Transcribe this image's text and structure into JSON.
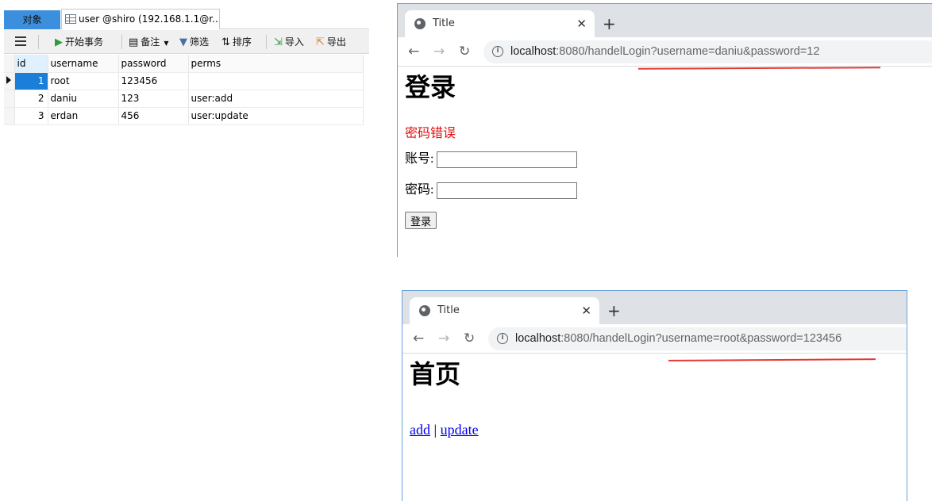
{
  "navicat": {
    "tab_objects": "对象",
    "tab_table": "user @shiro (192.168.1.1@r...",
    "toolbar": {
      "begin_transaction": "开始事务",
      "memo": "备注",
      "filter": "筛选",
      "sort": "排序",
      "import": "导入",
      "export": "导出"
    },
    "columns": [
      "id",
      "username",
      "password",
      "perms"
    ],
    "rows": [
      {
        "id": "1",
        "username": "root",
        "password": "123456",
        "perms": ""
      },
      {
        "id": "2",
        "username": "daniu",
        "password": "123",
        "perms": "user:add"
      },
      {
        "id": "3",
        "username": "erdan",
        "password": "456",
        "perms": "user:update"
      }
    ]
  },
  "browser1": {
    "tab_title": "Title",
    "url_host": "localhost",
    "url_rest": ":8080/handelLogin?username=daniu&password=12",
    "heading": "登录",
    "error": "密码错误",
    "account_label": "账号:",
    "password_label": "密码:",
    "login_button": "登录"
  },
  "browser2": {
    "tab_title": "Title",
    "url_host": "localhost",
    "url_rest": ":8080/handelLogin?username=root&password=123456",
    "heading": "首页",
    "link_add": "add",
    "separator": "|",
    "link_update": "update"
  },
  "colors": {
    "annotation_red": "#e53935",
    "selected_blue": "#1a7fd8",
    "error_red": "#e01010"
  }
}
